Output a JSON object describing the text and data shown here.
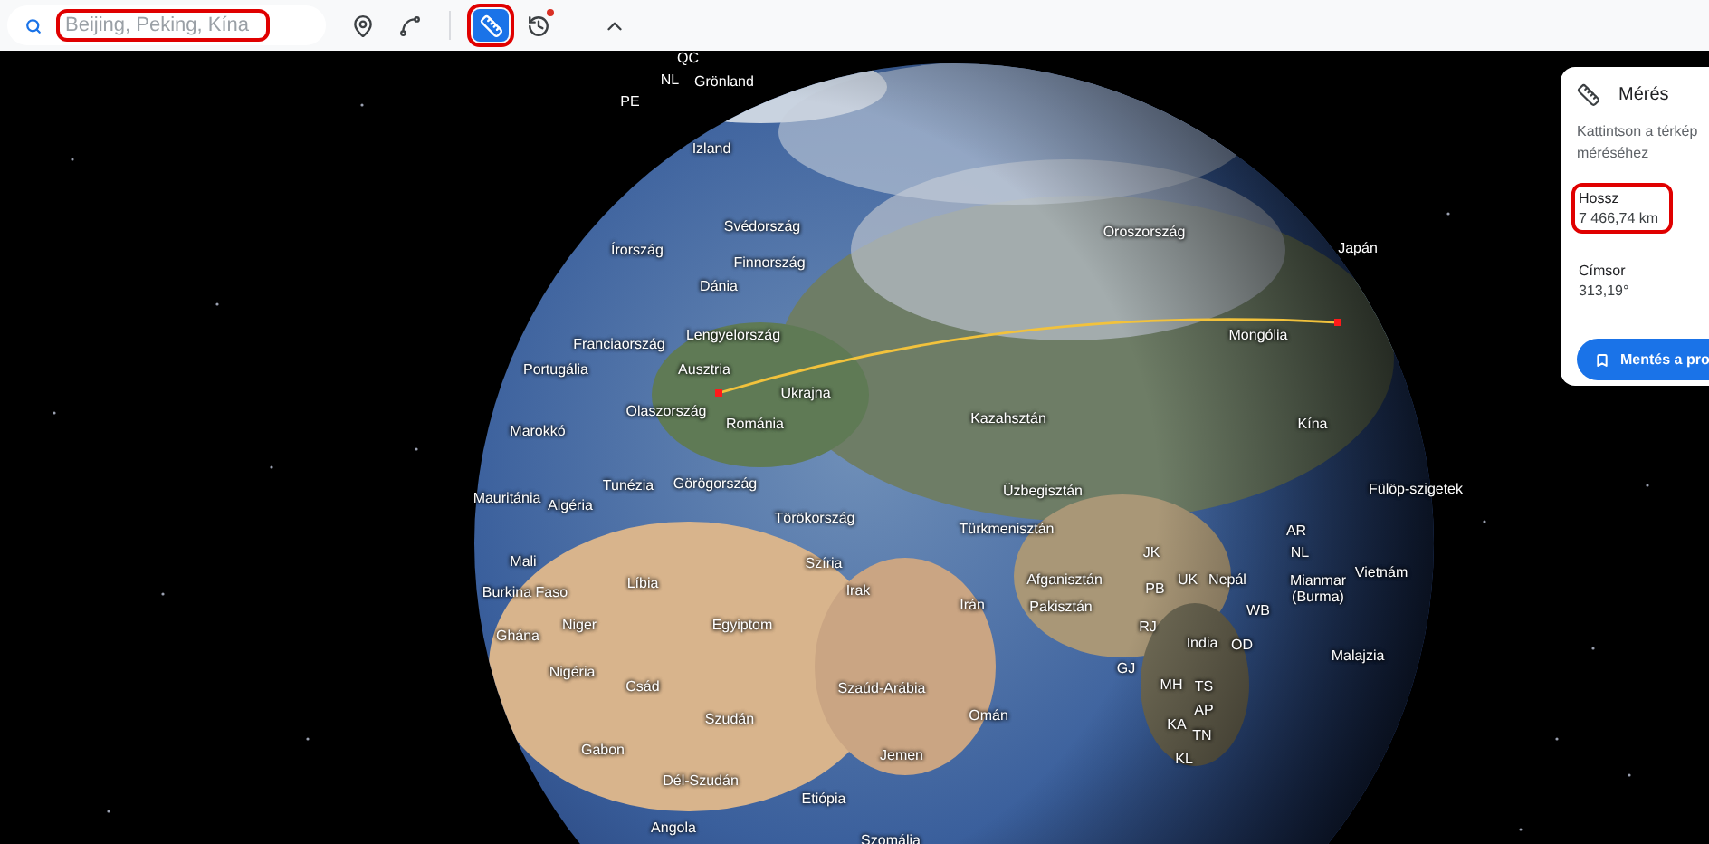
{
  "search": {
    "placeholder": "Beijing, Peking, Kína",
    "annotated": true
  },
  "toolbar": [
    {
      "kind": "pin",
      "selected": false
    },
    {
      "kind": "path",
      "selected": false
    },
    {
      "kind": "ruler",
      "selected": true
    },
    {
      "kind": "history",
      "selected": false,
      "notification": true
    },
    {
      "kind": "collapse",
      "selected": false
    }
  ],
  "map": {
    "labels": [
      "QC",
      "NL",
      "PE",
      "Grönland",
      "Izland",
      "Svédország",
      "Írország",
      "Finnország",
      "Dánia",
      "Franciaország",
      "Lengyelország",
      "Portugália",
      "Ausztria",
      "Ukrajna",
      "Olaszország",
      "Marokkó",
      "Románia",
      "Oroszország",
      "Japán",
      "Mongólia",
      "Kazahsztán",
      "Kína",
      "Tunézia",
      "Görögország",
      "Mauritánia",
      "Algéria",
      "Törökország",
      "Üzbegisztán",
      "Fülöp-szigetek",
      "Türkmenisztán",
      "Mali",
      "Szíria",
      "Líbia",
      "Burkina Faso",
      "Irak",
      "Afganisztán",
      "Irán",
      "Niger",
      "Egyiptom",
      "Pakisztán",
      "Ghána",
      "Nigéria",
      "Csád",
      "Szaúd-Arábia",
      "Szudán",
      "Omán",
      "Gabon",
      "Jemen",
      "Dél-Szudán",
      "Etiópia",
      "Angola",
      "Szomália",
      "JK",
      "UK",
      "Nepál",
      "PB",
      "AR",
      "NL",
      "Mianmar (Burma)",
      "Vietnám",
      "WB",
      "RJ",
      "India",
      "OD",
      "GJ",
      "MH",
      "TS",
      "AP",
      "KA",
      "TN",
      "KL",
      "Malajzia"
    ]
  },
  "measure_panel": {
    "title": "Mérés",
    "hint_lines": [
      "Kattintson a térkép",
      "méréséhez"
    ],
    "fields": [
      {
        "label": "Hossz",
        "value": "7 466,74 km",
        "annotated": true
      },
      {
        "label": "Címsor",
        "value": "313,19°",
        "annotated": false
      }
    ],
    "button": "Mentés a pro"
  }
}
